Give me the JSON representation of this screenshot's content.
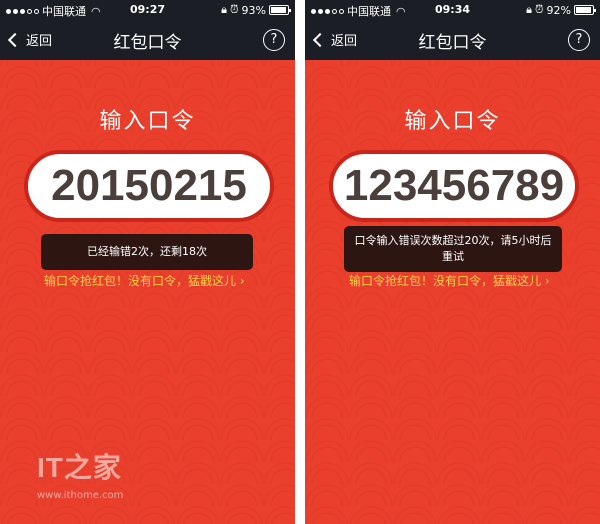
{
  "screens": [
    {
      "status": {
        "carrier": "中国联通",
        "time": "09:27",
        "battery": "93%",
        "battery_level": 0.93
      },
      "nav": {
        "back_label": "返回",
        "title": "红包口令",
        "help_glyph": "?"
      },
      "prompt_title": "输入口令",
      "code_value": "20150215",
      "toast_text": "已经输错2次，还剩18次",
      "hint_link": "输口令抢红包！没有口令，猛戳这儿 ›"
    },
    {
      "status": {
        "carrier": "中国联通",
        "time": "09:34",
        "battery": "92%",
        "battery_level": 0.92
      },
      "nav": {
        "back_label": "返回",
        "title": "红包口令",
        "help_glyph": "?"
      },
      "prompt_title": "输入口令",
      "code_value": "123456789",
      "toast_text": "口令输入错误次数超过20次，请5小时后重试",
      "hint_link": "输口令抢红包！没有口令，猛戳这儿 ›"
    }
  ],
  "watermark": {
    "logo": "IT之家",
    "url": "www.ithome.com"
  },
  "icons": {
    "signal": "signal-icon",
    "wifi": "wifi-icon",
    "lock": "lock-icon",
    "alarm": "alarm-icon",
    "battery": "battery-icon",
    "back": "chevron-left-icon",
    "help": "question-icon"
  },
  "colors": {
    "background": "#ea3f2c",
    "navbar": "#1b1e24",
    "code_border": "#c9261b",
    "hint": "#f7d24a"
  }
}
